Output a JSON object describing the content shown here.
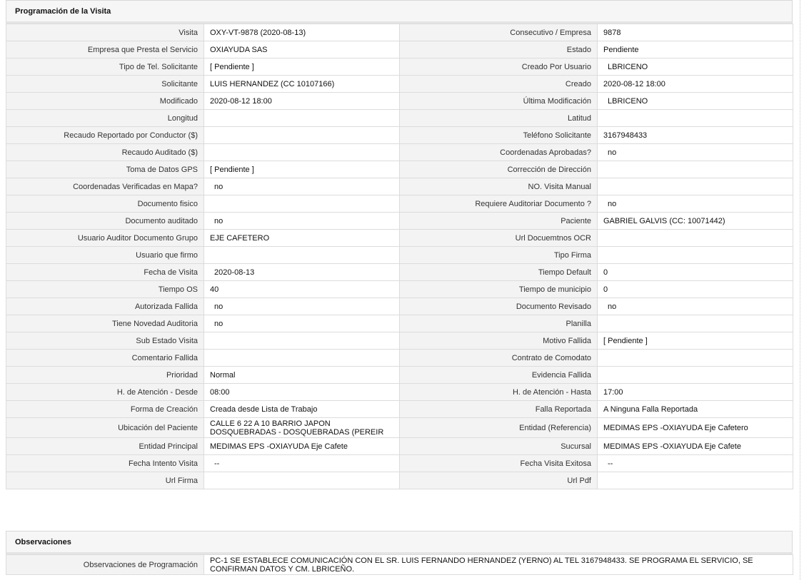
{
  "visit_panel": {
    "title": "Programación de la Visita",
    "rows": [
      {
        "l1": "Visita",
        "v1": "OXY-VT-9878 (2020-08-13)",
        "l2": "Consecutivo / Empresa",
        "v2": "9878"
      },
      {
        "l1": "Empresa que Presta el Servicio",
        "v1": "OXIAYUDA SAS",
        "l2": "Estado",
        "v2": "Pendiente"
      },
      {
        "l1": "Tipo de Tel. Solicitante",
        "v1": "[ Pendiente ]",
        "l2": "Creado Por Usuario",
        "v2": "LBRICENO"
      },
      {
        "l1": "Solicitante",
        "v1": "LUIS HERNANDEZ (CC 10107166)",
        "l2": "Creado",
        "v2": "2020-08-12 18:00"
      },
      {
        "l1": "Modificado",
        "v1": "2020-08-12 18:00",
        "l2": "Última Modificación",
        "v2": "LBRICENO"
      },
      {
        "l1": "Longitud",
        "v1": "",
        "l2": "Latitud",
        "v2": ""
      },
      {
        "l1": "Recaudo Reportado por Conductor ($)",
        "v1": "",
        "l2": "Teléfono Solicitante",
        "v2": "3167948433"
      },
      {
        "l1": "Recaudo Auditado ($)",
        "v1": "",
        "l2": "Coordenadas Aprobadas?",
        "v2": "no"
      },
      {
        "l1": "Toma de Datos GPS",
        "v1": "[ Pendiente ]",
        "l2": "Corrección de Dirección",
        "v2": ""
      },
      {
        "l1": "Coordenadas Verificadas en Mapa?",
        "v1": "no",
        "l2": "NO. Visita Manual",
        "v2": ""
      },
      {
        "l1": "Documento fisico",
        "v1": "",
        "l2": "Requiere Auditoriar Documento ?",
        "v2": "no"
      },
      {
        "l1": "Documento auditado",
        "v1": "no",
        "l2": "Paciente",
        "v2": "GABRIEL GALVIS (CC: 10071442)"
      },
      {
        "l1": "Usuario Auditor Documento Grupo",
        "v1": "EJE CAFETERO",
        "l2": "Url Docuemtnos OCR",
        "v2": ""
      },
      {
        "l1": "Usuario que firmo",
        "v1": "",
        "l2": "Tipo Firma",
        "v2": ""
      },
      {
        "l1": "Fecha de Visita",
        "v1": "2020-08-13",
        "l2": "Tiempo Default",
        "v2": "0"
      },
      {
        "l1": "Tiempo OS",
        "v1": "40",
        "l2": "Tiempo de municipio",
        "v2": "0"
      },
      {
        "l1": "Autorizada Fallida",
        "v1": "no",
        "l2": "Documento Revisado",
        "v2": "no"
      },
      {
        "l1": "Tiene Novedad Auditoria",
        "v1": "no",
        "l2": "Planilla",
        "v2": ""
      },
      {
        "l1": "Sub Estado Visita",
        "v1": "",
        "l2": "Motivo Fallida",
        "v2": "[ Pendiente ]"
      },
      {
        "l1": "Comentario Fallida",
        "v1": "",
        "l2": "Contrato de Comodato",
        "v2": ""
      },
      {
        "l1": "Prioridad",
        "v1": "Normal",
        "l2": "Evidencia Fallida",
        "v2": ""
      },
      {
        "l1": "H. de Atención - Desde",
        "v1": "08:00",
        "l2": "H. de Atención - Hasta",
        "v2": "17:00"
      },
      {
        "l1": "Forma de Creación",
        "v1": "Creada desde Lista de Trabajo",
        "l2": "Falla Reportada",
        "v2": "A Ninguna Falla Reportada"
      },
      {
        "l1": "Ubicación del Paciente",
        "v1": "CALLE 6 22 A 10 BARRIO JAPON DOSQUEBRADAS - DOSQUEBRADAS (PEREIR",
        "l2": "Entidad (Referencia)",
        "v2": "MEDIMAS EPS -OXIAYUDA Eje Cafetero"
      },
      {
        "l1": "Entidad Principal",
        "v1": "MEDIMAS EPS -OXIAYUDA Eje Cafete",
        "l2": "Sucursal",
        "v2": "MEDIMAS EPS -OXIAYUDA Eje Cafete"
      },
      {
        "l1": "Fecha Intento Visita",
        "v1": "--",
        "l2": "Fecha Visita Exitosa",
        "v2": "--"
      },
      {
        "l1": "Url Firma",
        "v1": "",
        "l2": "Url Pdf",
        "v2": ""
      }
    ]
  },
  "obs_panel": {
    "title": "Observaciones",
    "label": "Observaciones de Programación",
    "value": "PC-1 SE ESTABLECE COMUNICACIÓN CON EL SR. LUIS FERNANDO HERNANDEZ (YERNO) AL TEL 3167948433. SE PROGRAMA EL SERVICIO, SE CONFIRMAN DATOS Y CM. LBRICEÑO."
  }
}
